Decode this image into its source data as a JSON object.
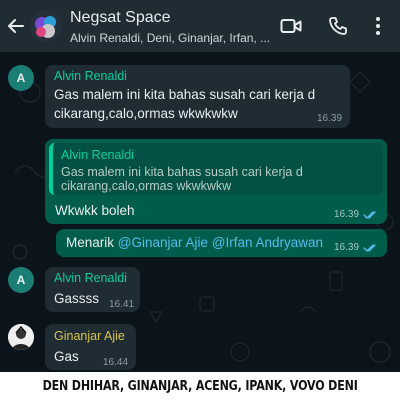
{
  "header": {
    "title": "Negsat Space",
    "members": "Alvin Renaldi, Deni, Ginanjar, Irfan, ..."
  },
  "messages": [
    {
      "sender": "Alvin Renaldi",
      "avatar_letter": "A",
      "text_line1": "Gas malem ini kita bahas susah cari kerja d",
      "text_line2": "cikarang,calo,ormas wkwkwkw",
      "time": "16.39"
    },
    {
      "quote_sender": "Alvin Renaldi",
      "quote_line1": "Gas malem ini kita bahas susah cari kerja d",
      "quote_line2": "cikarang,calo,ormas wkwkwkw",
      "text": "Wkwkk boleh",
      "time": "16.39"
    },
    {
      "text_prefix": "Menarik ",
      "mention1": "@Ginanjar Ajie",
      "mention2": "@Irfan Andryawan",
      "time": "16.39"
    },
    {
      "sender": "Alvin Renaldi",
      "avatar_letter": "A",
      "text": "Gassss",
      "time": "16.41"
    },
    {
      "sender": "Ginanjar Ajie",
      "text": "Gas",
      "time": "16.44"
    }
  ],
  "caption": "DEN DHIHAR, GINANJAR, ACENG, IPANK, VOVO DENI",
  "colors": {
    "header_bg": "#1f2c34",
    "chat_bg": "#0b141a",
    "incoming_bubble": "#1f2c34",
    "outgoing_bubble": "#005c4b",
    "sender_alvin": "#06cf9c",
    "sender_ginanjar": "#d9c44a",
    "mention": "#53bdeb",
    "read_ticks": "#53bdeb"
  },
  "icons": [
    "back-arrow-icon",
    "video-call-icon",
    "phone-call-icon",
    "more-vertical-icon",
    "double-check-icon"
  ]
}
